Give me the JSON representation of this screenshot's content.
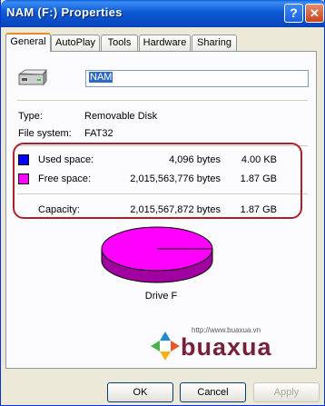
{
  "window": {
    "title": "NAM (F:) Properties"
  },
  "tabs": [
    {
      "label": "General"
    },
    {
      "label": "AutoPlay"
    },
    {
      "label": "Tools"
    },
    {
      "label": "Hardware"
    },
    {
      "label": "Sharing"
    }
  ],
  "general": {
    "name_value": "NAM",
    "type_label": "Type:",
    "type_value": "Removable Disk",
    "fs_label": "File system:",
    "fs_value": "FAT32",
    "used_label": "Used space:",
    "used_bytes": "4,096 bytes",
    "used_size": "4.00 KB",
    "used_color": "#0000ff",
    "free_label": "Free space:",
    "free_bytes": "2,015,563,776 bytes",
    "free_size": "1.87 GB",
    "free_color": "#ff00ff",
    "capacity_label": "Capacity:",
    "capacity_bytes": "2,015,567,872 bytes",
    "capacity_size": "1.87 GB",
    "drive_label": "Drive F",
    "used_fraction": 2e-06
  },
  "watermark": {
    "url": "http://www.buaxua.vn",
    "brand": "buaxua"
  },
  "buttons": {
    "ok": "OK",
    "cancel": "Cancel",
    "apply": "Apply"
  }
}
